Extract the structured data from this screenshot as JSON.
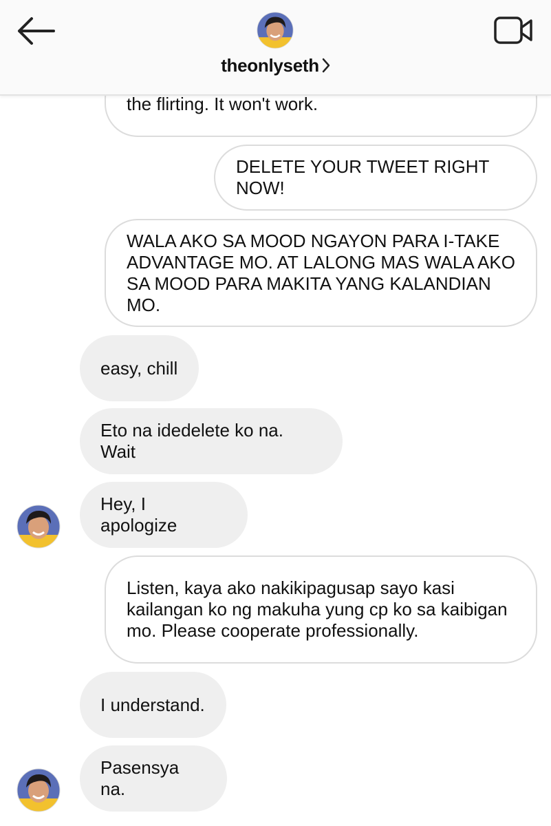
{
  "header": {
    "username": "theonlyseth",
    "back_icon": "back-arrow-icon",
    "video_icon": "video-call-icon",
    "chevron_icon": "chevron-right-icon"
  },
  "messages": [
    {
      "direction": "outgoing",
      "text": "the flirting. It won't work."
    },
    {
      "direction": "outgoing",
      "text": "DELETE YOUR TWEET RIGHT NOW!"
    },
    {
      "direction": "outgoing",
      "text": "WALA AKO SA MOOD NGAYON PARA I-TAKE\nADVANTAGE MO. AT LALONG MAS WALA AKO\nSA MOOD PARA MAKITA YANG KALANDIAN MO."
    },
    {
      "direction": "incoming",
      "text": "easy, chill"
    },
    {
      "direction": "incoming",
      "text": "Eto na idedelete ko na. Wait"
    },
    {
      "direction": "incoming",
      "text": "Hey, I apologize"
    },
    {
      "direction": "outgoing",
      "text": "Listen, kaya ako nakikipagusap sayo kasi\nkailangan ko ng makuha yung cp ko sa kaibigan\nmo. Please cooperate professionally."
    },
    {
      "direction": "incoming",
      "text": "I understand."
    },
    {
      "direction": "incoming",
      "text": "Pasensya na."
    }
  ],
  "colors": {
    "header_bg": "#fafafa",
    "incoming_bubble": "#efefef",
    "outgoing_border": "#dcdcdc",
    "avatar_shirt": "#f2c12e"
  }
}
